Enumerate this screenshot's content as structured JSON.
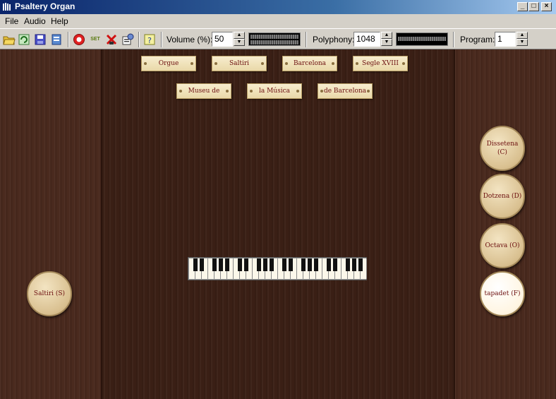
{
  "window": {
    "title": "Psaltery Organ"
  },
  "menu": [
    {
      "label": "File"
    },
    {
      "label": "Audio"
    },
    {
      "label": "Help"
    }
  ],
  "toolbar": {
    "volume_label": "Volume (%):",
    "volume_value": "50",
    "polyphony_label": "Polyphony:",
    "polyphony_value": "1048",
    "program_label": "Program:",
    "program_value": "1",
    "icons": [
      "open-icon",
      "reload-icon",
      "save-icon",
      "properties-icon",
      "record-icon",
      "set-icon",
      "panic-icon",
      "settings-icon",
      "help-icon"
    ],
    "set_icon_text": "SET"
  },
  "labels": {
    "row1": [
      "Orgue",
      "Saltiri",
      "Barcelona",
      "Segle XVIII"
    ],
    "row2": [
      "Museu de",
      "la Música",
      "de Barcelona"
    ]
  },
  "stops": {
    "left": [
      {
        "line1": "Saltiri (S)",
        "line2": "",
        "active": false
      }
    ],
    "right": [
      {
        "line1": "Dissetena",
        "line2": "(C)",
        "active": false
      },
      {
        "line1": "Dotzena (D)",
        "line2": "",
        "active": false
      },
      {
        "line1": "Octava (O)",
        "line2": "",
        "active": false
      },
      {
        "line1": "tapadet (F)",
        "line2": "",
        "active": true
      }
    ]
  },
  "keyboard": {
    "white_keys": 28
  },
  "colors": {
    "wood": "#3f2218",
    "plaque_text": "#6b0e0e",
    "title_bar": "#0a246a"
  }
}
